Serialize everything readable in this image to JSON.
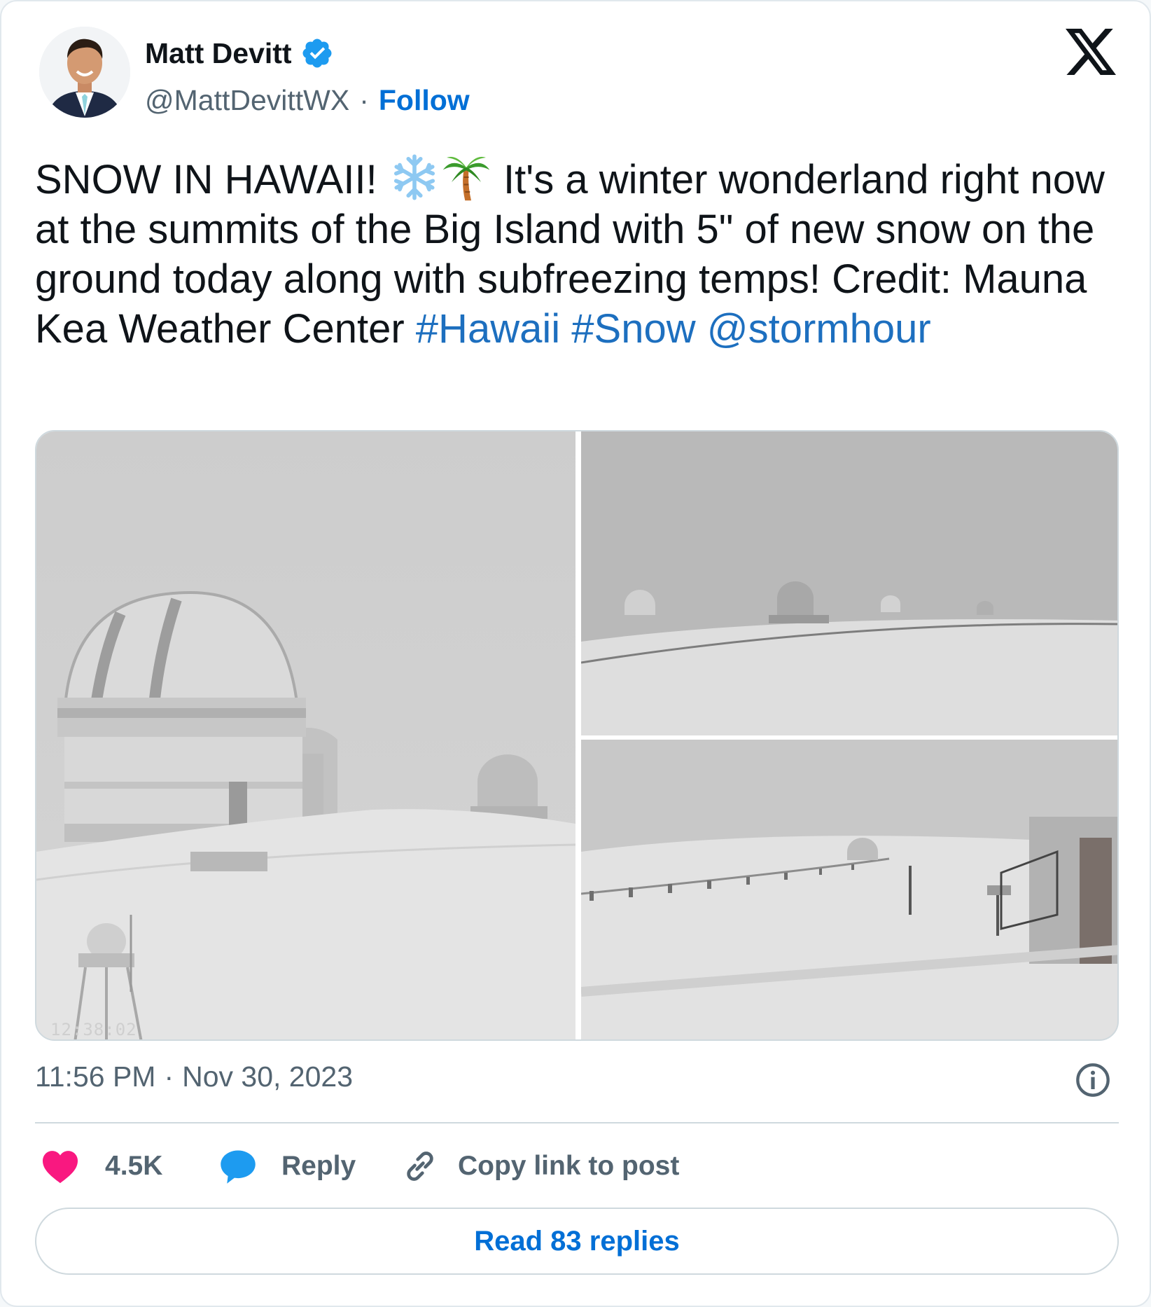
{
  "author": {
    "name": "Matt Devitt",
    "handle": "@MattDevittWX",
    "separator": "·",
    "follow_label": "Follow",
    "verified": true
  },
  "tweet": {
    "text_1": "SNOW IN HAWAII!",
    "emoji_1": "snowflake",
    "emoji_2": "palm-tree",
    "text_2": "It's a winter wonderland right now at the summits of the Big Island with 5\" of new snow on the ground today along with subfreezing temps! Credit: Mauna Kea Weather Center",
    "hashtag_1": "#Hawaii",
    "hashtag_2": "#Snow",
    "mention": "@stormhour"
  },
  "media": {
    "photo_1_stamp": "12:38:02",
    "photo_count": 3
  },
  "meta": {
    "time": "11:56 PM",
    "separator": "·",
    "date": "Nov 30, 2023"
  },
  "actions": {
    "like_count": "4.5K",
    "reply_label": "Reply",
    "copy_label": "Copy link to post",
    "read_replies_label": "Read 83 replies"
  },
  "colors": {
    "link": "#006fd6",
    "like": "#f91880",
    "reply": "#1d9bf0",
    "secondary_text": "#536471"
  }
}
